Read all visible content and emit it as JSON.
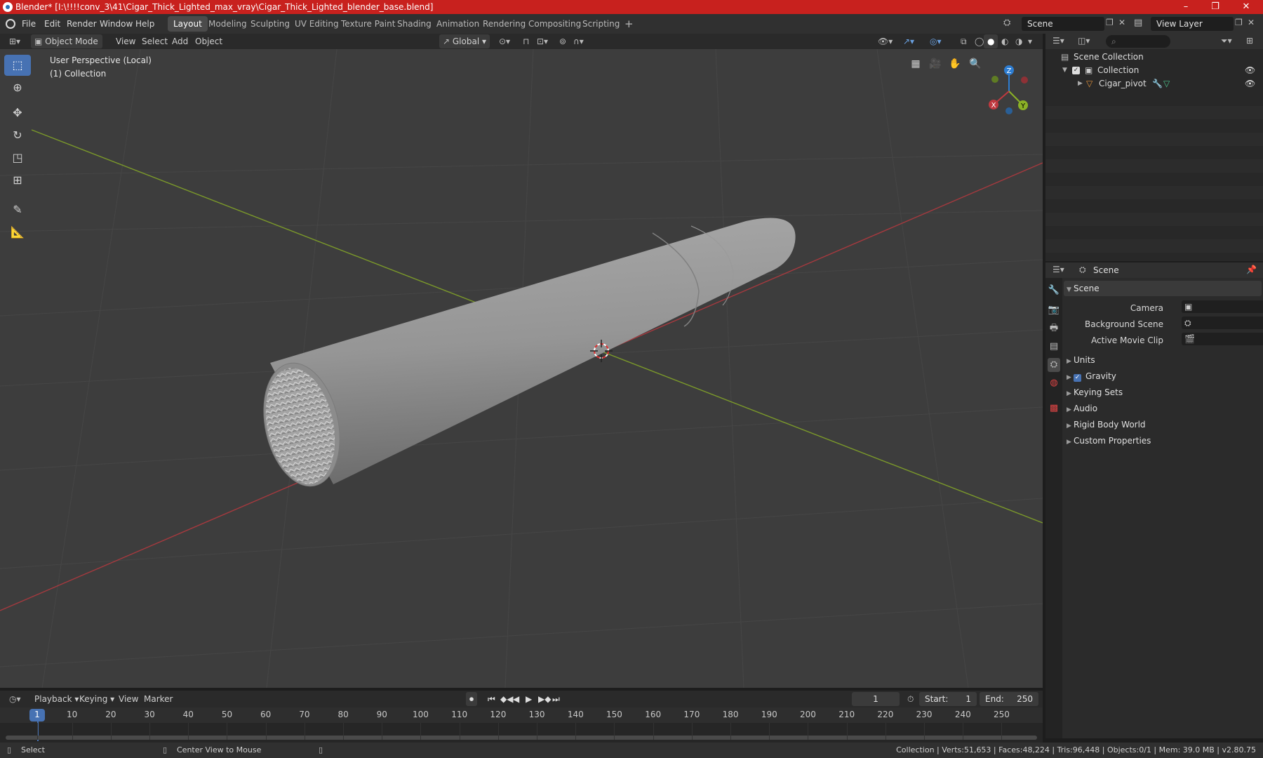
{
  "window": {
    "title": "Blender* [I:\\!!!!conv_3\\41\\Cigar_Thick_Lighted_max_vray\\Cigar_Thick_Lighted_blender_base.blend]",
    "minimize": "–",
    "maximize": "❐",
    "close": "✕"
  },
  "menu": {
    "items": [
      "File",
      "Edit",
      "Render",
      "Window",
      "Help"
    ],
    "workspaces": [
      "Layout",
      "Modeling",
      "Sculpting",
      "UV Editing",
      "Texture Paint",
      "Shading",
      "Animation",
      "Rendering",
      "Compositing",
      "Scripting"
    ],
    "add_workspace": "+",
    "scene_name": "Scene",
    "view_layer": "View Layer"
  },
  "viewport_header": {
    "mode": "Object Mode",
    "menus": [
      "View",
      "Select",
      "Add",
      "Object"
    ],
    "transform_orientation": "Global"
  },
  "viewport": {
    "perspective": "User Perspective (Local)",
    "collection": "(1) Collection",
    "gizmo": {
      "x": "X",
      "y": "Y",
      "z": "Z"
    },
    "colors": {
      "x_axis": "#c0393f",
      "y_axis": "#8bb126",
      "z_axis": "#2d7dd2",
      "background": "#3d3d3d",
      "selection": "#4772b3"
    }
  },
  "outliner": {
    "items": [
      {
        "label": "Scene Collection"
      },
      {
        "label": "Collection"
      },
      {
        "label": "Cigar_pivot"
      }
    ]
  },
  "properties": {
    "context": "Scene",
    "section": "Scene",
    "fields": [
      {
        "label": "Camera"
      },
      {
        "label": "Background Scene"
      },
      {
        "label": "Active Movie Clip"
      }
    ],
    "panels": [
      "Units",
      "Gravity",
      "Keying Sets",
      "Audio",
      "Rigid Body World",
      "Custom Properties"
    ],
    "gravity_checked": true
  },
  "timeline": {
    "menus": [
      "Playback",
      "Keying",
      "View",
      "Marker"
    ],
    "current_frame": "1",
    "start_label": "Start:",
    "start": "1",
    "end_label": "End:",
    "end": "250",
    "ticks": [
      "1",
      "10",
      "20",
      "30",
      "40",
      "50",
      "60",
      "70",
      "80",
      "90",
      "100",
      "110",
      "120",
      "130",
      "140",
      "150",
      "160",
      "170",
      "180",
      "190",
      "200",
      "210",
      "220",
      "230",
      "240",
      "250"
    ]
  },
  "statusbar": {
    "select": "Select",
    "center_view": "Center View to Mouse",
    "stats": "Collection | Verts:51,653 | Faces:48,224 | Tris:96,448 | Objects:0/1 | Mem: 39.0 MB | v2.80.75"
  }
}
